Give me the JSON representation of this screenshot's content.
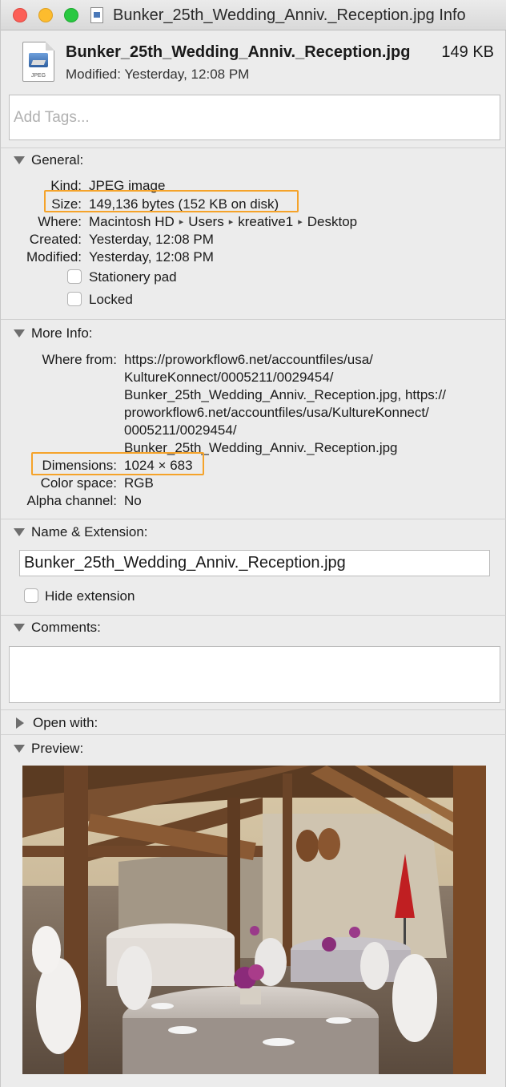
{
  "window": {
    "title": "Bunker_25th_Wedding_Anniv._Reception.jpg Info"
  },
  "header": {
    "file_name": "Bunker_25th_Wedding_Anniv._Reception.jpg",
    "file_size": "149 KB",
    "modified": "Modified: Yesterday, 12:08 PM",
    "icon_label": "JPEG",
    "tags_placeholder": "Add Tags..."
  },
  "general": {
    "title": "General:",
    "kind_label": "Kind:",
    "kind_value": "JPEG image",
    "size_label": "Size:",
    "size_value": "149,136 bytes (152 KB on disk)",
    "where_label": "Where:",
    "where_path": [
      "Macintosh HD",
      "Users",
      "kreative1",
      "Desktop"
    ],
    "created_label": "Created:",
    "created_value": "Yesterday, 12:08 PM",
    "modified_label": "Modified:",
    "modified_value": "Yesterday, 12:08 PM",
    "stationery_label": "Stationery pad",
    "locked_label": "Locked"
  },
  "more_info": {
    "title": "More Info:",
    "where_from_label": "Where from:",
    "where_from_lines": [
      "https://proworkflow6.net/accountfiles/usa/",
      "KultureKonnect/0005211/0029454/",
      "Bunker_25th_Wedding_Anniv._Reception.jpg, https://",
      "proworkflow6.net/accountfiles/usa/KultureKonnect/",
      "0005211/0029454/",
      "Bunker_25th_Wedding_Anniv._Reception.jpg"
    ],
    "dimensions_label": "Dimensions:",
    "dimensions_value": "1024 × 683",
    "color_space_label": "Color space:",
    "color_space_value": "RGB",
    "alpha_label": "Alpha channel:",
    "alpha_value": "No"
  },
  "name_extension": {
    "title": "Name & Extension:",
    "name_value": "Bunker_25th_Wedding_Anniv._Reception.jpg",
    "hide_extension_label": "Hide extension"
  },
  "comments": {
    "title": "Comments:"
  },
  "open_with": {
    "title": "Open with:"
  },
  "preview": {
    "title": "Preview:"
  },
  "colors": {
    "highlight": "#f5a32a",
    "close": "#fc5f57",
    "minimize": "#fdbc2e",
    "zoom": "#28c840"
  }
}
